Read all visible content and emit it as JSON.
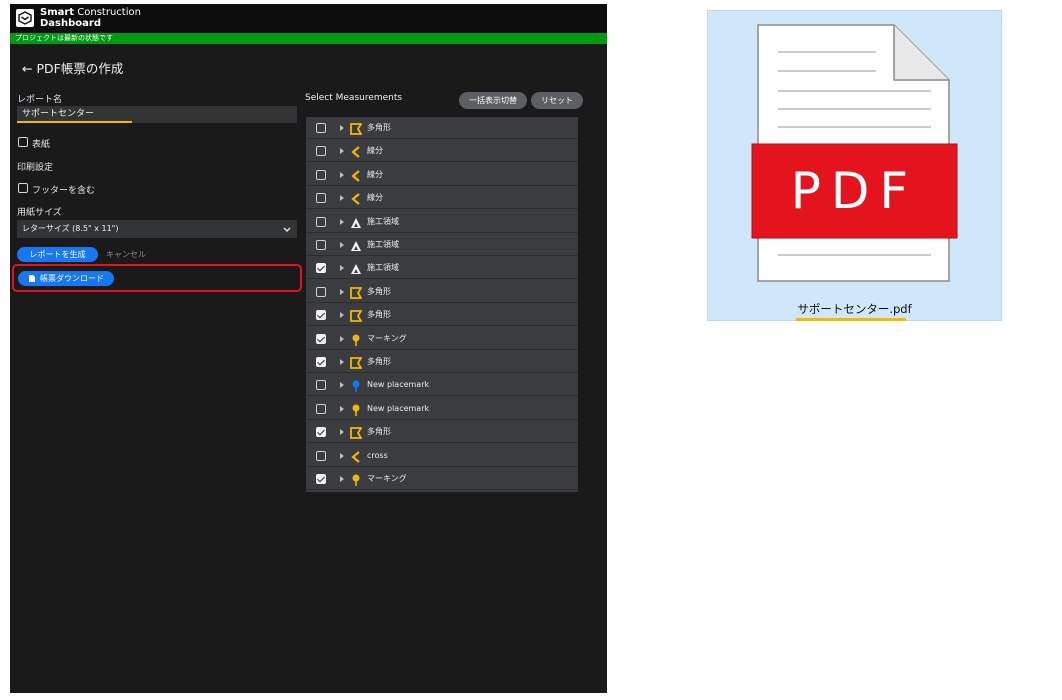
{
  "brand": {
    "line1_bold": "Smart",
    "line1_rest": " Construction",
    "line2": "Dashboard"
  },
  "status_bar": "プロジェクトは最新の状態です",
  "page": {
    "back_arrow": "←",
    "title": "PDF帳票の作成"
  },
  "form": {
    "report_name_label": "レポート名",
    "report_name_value": "サポートセンター",
    "cover_label": "表紙",
    "print_settings_label": "印刷設定",
    "footer_label": "フッターを含む",
    "paper_size_label": "用紙サイズ",
    "paper_size_value": "レターサイズ (8.5\" x 11\")",
    "generate_button": "レポートを生成",
    "cancel_button": "キャンセル",
    "download_button": "帳票ダウンロード"
  },
  "measurements": {
    "title": "Select Measurements",
    "toggle_button": "一括表示切替",
    "reset_button": "リセット",
    "items": [
      {
        "label": "多角形",
        "icon": "polygon-icon",
        "checked": false
      },
      {
        "label": "線分",
        "icon": "line-icon",
        "checked": false
      },
      {
        "label": "線分",
        "icon": "line-icon",
        "checked": false
      },
      {
        "label": "線分",
        "icon": "line-icon",
        "checked": false
      },
      {
        "label": "施工領域",
        "icon": "area-icon",
        "checked": false
      },
      {
        "label": "施工領域",
        "icon": "area-icon",
        "checked": false
      },
      {
        "label": "施工領域",
        "icon": "area-icon",
        "checked": true
      },
      {
        "label": "多角形",
        "icon": "polygon-icon",
        "checked": false
      },
      {
        "label": "多角形",
        "icon": "polygon-icon",
        "checked": true
      },
      {
        "label": "マーキング",
        "icon": "marker-yellow-icon",
        "checked": true
      },
      {
        "label": "多角形",
        "icon": "polygon-icon",
        "checked": true
      },
      {
        "label": "New placemark",
        "icon": "placemark-blue-icon",
        "checked": false
      },
      {
        "label": "New placemark",
        "icon": "marker-yellow-icon",
        "checked": false
      },
      {
        "label": "多角形",
        "icon": "polygon-icon",
        "checked": true
      },
      {
        "label": "cross",
        "icon": "line-icon",
        "checked": false
      },
      {
        "label": "マーキング",
        "icon": "marker-yellow-icon",
        "checked": true
      }
    ]
  },
  "file": {
    "badge": "PDF",
    "name": "サポートセンター.pdf"
  },
  "colors": {
    "accent_blue": "#1877f2",
    "status_green": "#009a13",
    "highlight_red": "#e3141d",
    "pdf_red": "#e3141d",
    "underline_yellow": "#f5b800",
    "icon_yellow": "#f2b705"
  }
}
